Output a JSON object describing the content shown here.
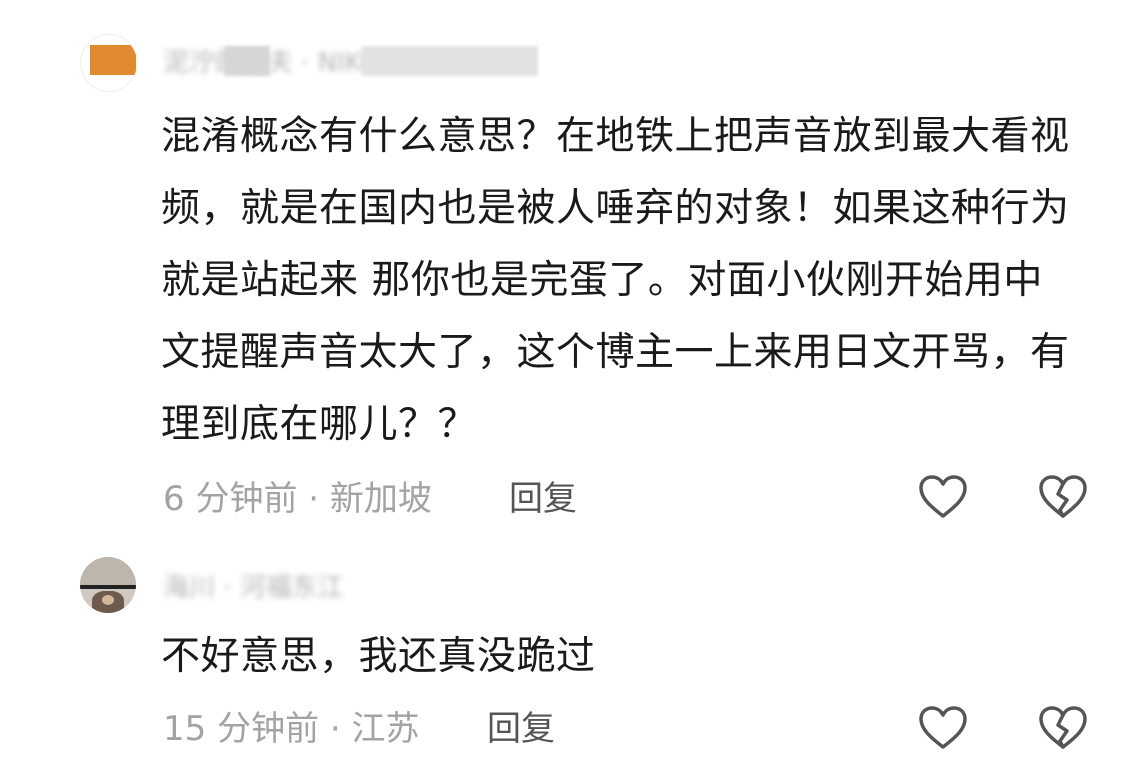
{
  "comments": [
    {
      "username": "泥泞的船夫 · NIKO",
      "text": "混淆概念有什么意思？在地铁上把声音放到最大看视频，就是在国内也是被人唾弃的对象！如果这种行为就是站起来 那你也是完蛋了。对面小伙刚开始用中文提醒声音太大了，这个博主一上来用日文开骂，有理到底在哪儿？？",
      "time_location": "6 分钟前 · 新加坡",
      "reply_label": "回复"
    },
    {
      "username": "海川 · 河福东江",
      "text": "不好意思，我还真没跪过",
      "time_location": "15 分钟前 · 江苏",
      "reply_label": "回复"
    }
  ],
  "icons": {
    "like": "heart-outline-icon",
    "dislike": "broken-heart-outline-icon"
  },
  "colors": {
    "body_text": "#1a1a1a",
    "meta_text": "#a3a3a3",
    "reply_text": "#555555",
    "icon_stroke": "#555555"
  }
}
